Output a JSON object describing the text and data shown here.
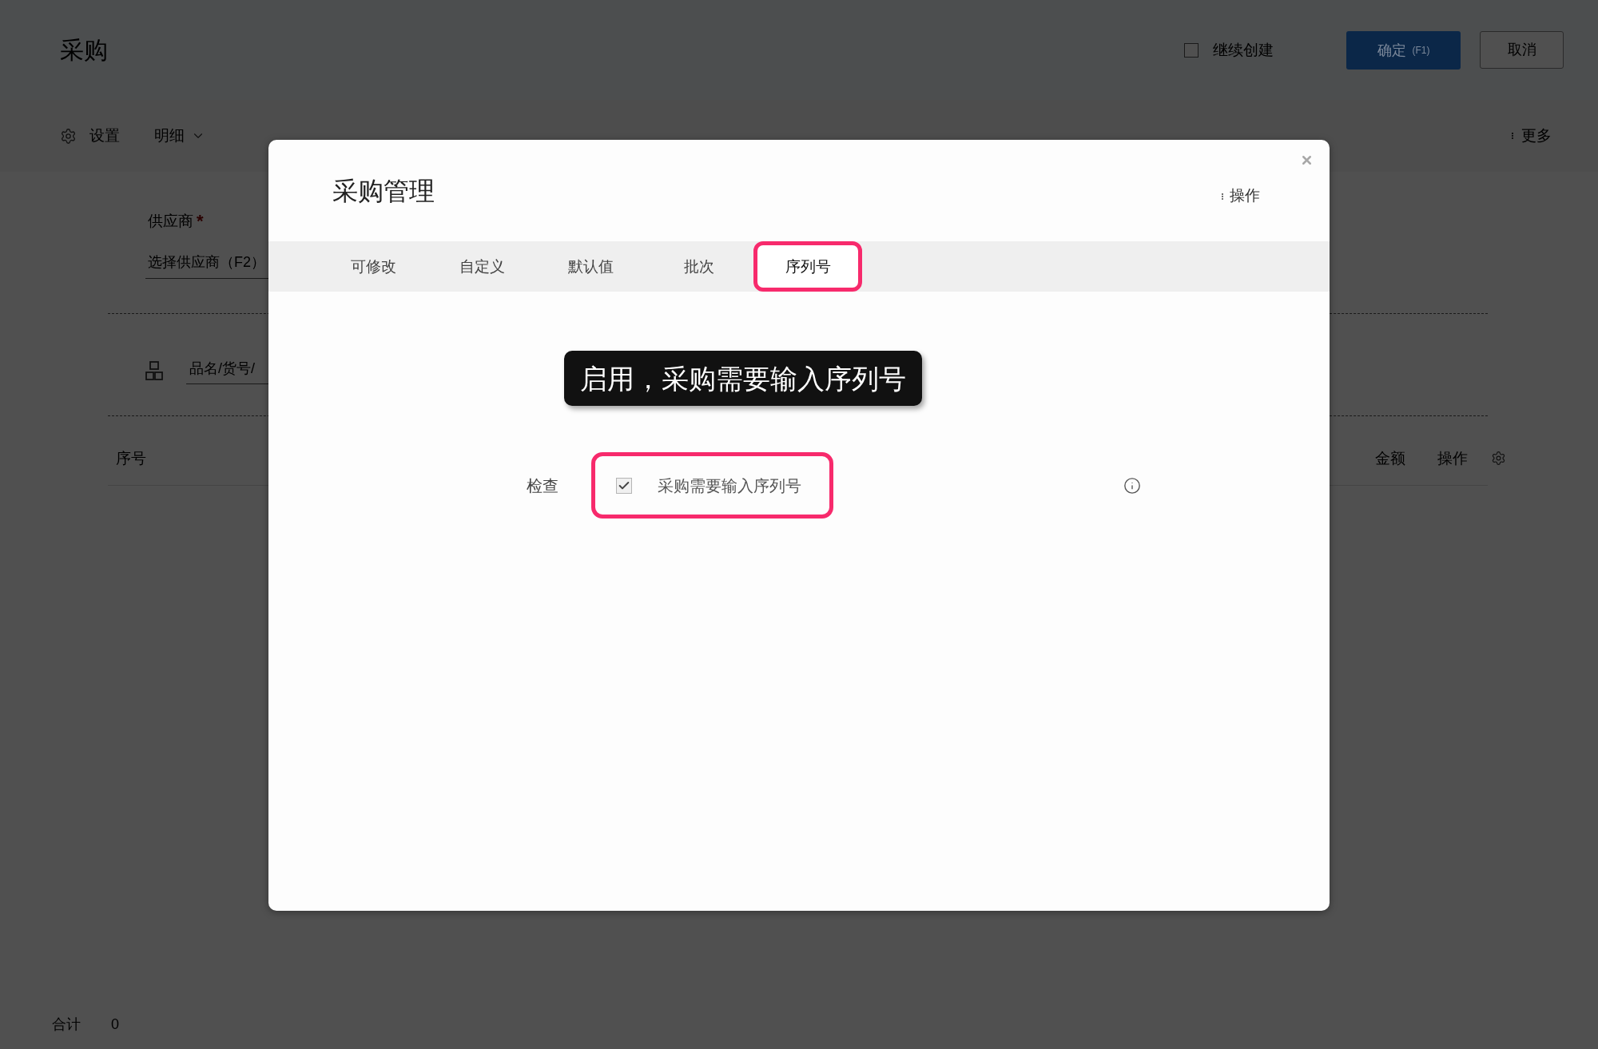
{
  "page": {
    "title": "采购",
    "continue_create": {
      "label": "继续创建",
      "checked": false
    },
    "confirm_button": {
      "label": "确定",
      "shortcut": "(F1)"
    },
    "cancel_button": "取消"
  },
  "toolbar": {
    "settings": "设置",
    "detail": "明细",
    "more": "更多"
  },
  "form": {
    "supplier_label": "供应商",
    "required_mark": "*",
    "supplier_placeholder": "选择供应商（F2）",
    "product_placeholder": "品名/货号/"
  },
  "table": {
    "columns": [
      "序号",
      "金额",
      "操作"
    ]
  },
  "footer": {
    "total_label": "合计",
    "total": "0"
  },
  "dialog": {
    "title": "采购管理",
    "actions_label": "操作",
    "tabs": [
      {
        "label": "可修改",
        "selected": false,
        "highlighted": false
      },
      {
        "label": "自定义",
        "selected": false,
        "highlighted": false
      },
      {
        "label": "默认值",
        "selected": false,
        "highlighted": false
      },
      {
        "label": "批次",
        "selected": false,
        "highlighted": false
      },
      {
        "label": "序列号",
        "selected": true,
        "highlighted": true
      }
    ],
    "callout": "启用，采购需要输入序列号",
    "settings": [
      {
        "label": "检查",
        "option": "采购需要输入序列号",
        "checked": true,
        "highlighted": true
      }
    ]
  }
}
